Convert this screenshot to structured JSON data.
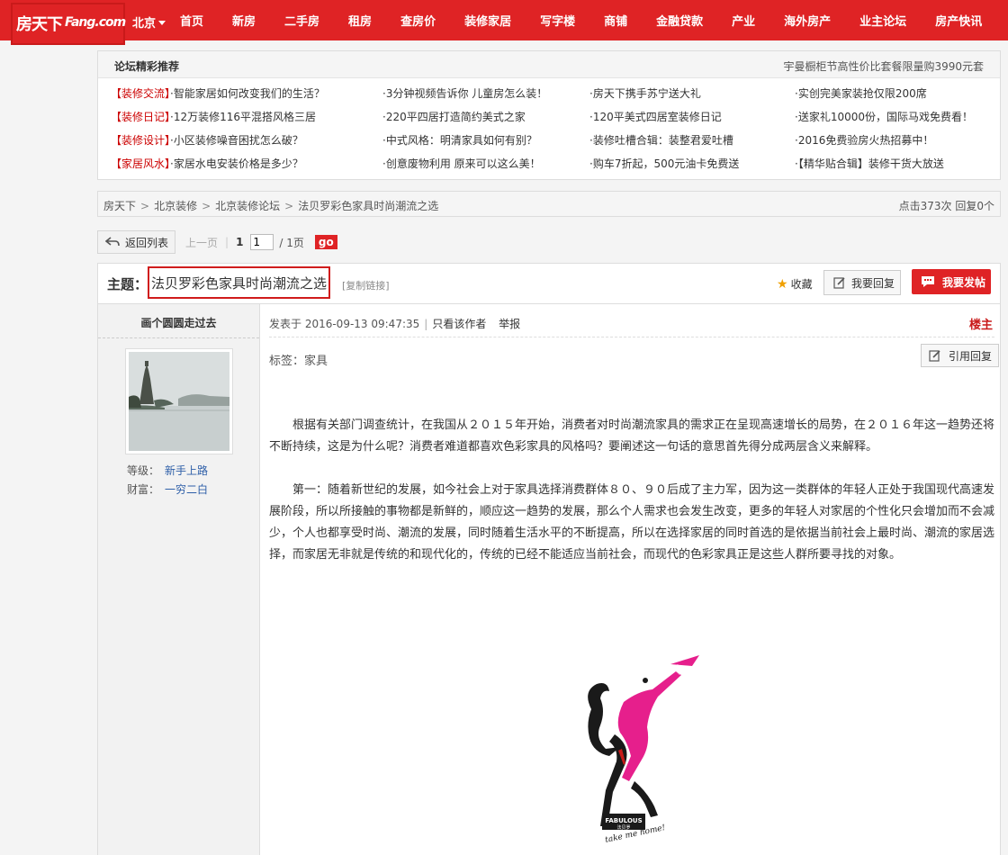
{
  "topnav": {
    "logo_zh": "房天下",
    "logo_en": "Fang.com",
    "city": "北京",
    "links": [
      "首页",
      "新房",
      "二手房",
      "租房",
      "查房价",
      "装修家居",
      "写字楼",
      "商铺",
      "金融贷款",
      "产业",
      "海外房产",
      "业主论坛",
      "房产快讯"
    ]
  },
  "recommend": {
    "title": "论坛精彩推荐",
    "ad": "宇曼橱柜节高性价比套餐限量购3990元套",
    "rows": [
      {
        "tag": "【装修交流】",
        "items": [
          "·智能家居如何改变我们的生活？",
          "·3分钟视频告诉你 儿童房怎么装！",
          "·房天下携手苏宁送大礼",
          "·实创完美家装抢仅限200席"
        ]
      },
      {
        "tag": "【装修日记】",
        "items": [
          "·12万装修116平混搭风格三居",
          "·220平四居打造简约美式之家",
          "·120平美式四居室装修日记",
          "·送家礼10000份，国际马戏免费看！"
        ]
      },
      {
        "tag": "【装修设计】",
        "items": [
          "·小区装修噪音困扰怎么破？",
          "·中式风格：明清家具如何有别？",
          "·装修吐槽合辑：装整君爱吐槽",
          "·2016免费验房火热招募中！"
        ]
      },
      {
        "tag": "【家居风水】",
        "items": [
          "·家居水电安装价格是多少？",
          "·创意废物利用 原来可以这么美！",
          "·购车7折起，500元油卡免费送",
          "·【精华贴合辑】装修干货大放送"
        ]
      }
    ]
  },
  "breadcrumb": {
    "items": [
      "房天下",
      "北京装修",
      "北京装修论坛",
      "法贝罗彩色家具时尚潮流之选"
    ],
    "separator": ">",
    "stats": "点击373次 回复0个"
  },
  "pager": {
    "back_label": "返回列表",
    "prev_label": "上一页",
    "current": "1",
    "input_value": "1",
    "total": "/ 1页",
    "go_label": "go"
  },
  "subject": {
    "label": "主题：",
    "title": "法贝罗彩色家具时尚潮流之选",
    "copy_link": "[复制链接]",
    "favorite": "收藏",
    "reply": "我要回复",
    "post": "我要发帖"
  },
  "author": {
    "name": "画个圆圆走过去",
    "level_label": "等级：",
    "level": "新手上路",
    "wealth_label": "财富：",
    "wealth": "一穷二白"
  },
  "post": {
    "posted_at": "发表于 2016-09-13 09:47:35",
    "only_author": "只看该作者",
    "report": "举报",
    "floor": "楼主",
    "tags": "标签：家具",
    "quote_reply": "引用回复",
    "paragraphs": [
      "根据有关部门调查统计，在我国从２０１５年开始，消费者对时尚潮流家具的需求正在呈现高速增长的局势，在２０１６年这一趋势还将不断持续，这是为什么呢？消费者难道都喜欢色彩家具的风格吗？要阐述这一句话的意思首先得分成两层含义来解释。",
      "第一：随着新世纪的发展，如今社会上对于家具选择消费群体８０、９０后成了主力军，因为这一类群体的年轻人正处于我国现代高速发展阶段，所以所接触的事物都是新鲜的，顺应这一趋势的发展，那么个人需求也会发生改变，更多的年轻人对家居的个性化只会增加而不会减少，个人也都享受时尚、潮流的发展，同时随着生活水平的不断提高，所以在选择家居的同时首选的是依据当前社会上最时尚、潮流的家居选择，而家居无非就是传统的和现代化的，传统的已经不能适应当前社会，而现代的色彩家具正是这些人群所要寻找的对象。"
    ],
    "brand_logo": {
      "brand": "FABULOUS",
      "zh": "法贝罗",
      "slogan": "take me home!"
    }
  },
  "colors": {
    "brand_red": "#df2325",
    "link_blue": "#2e5fa8",
    "tag_red": "#cc0000"
  }
}
